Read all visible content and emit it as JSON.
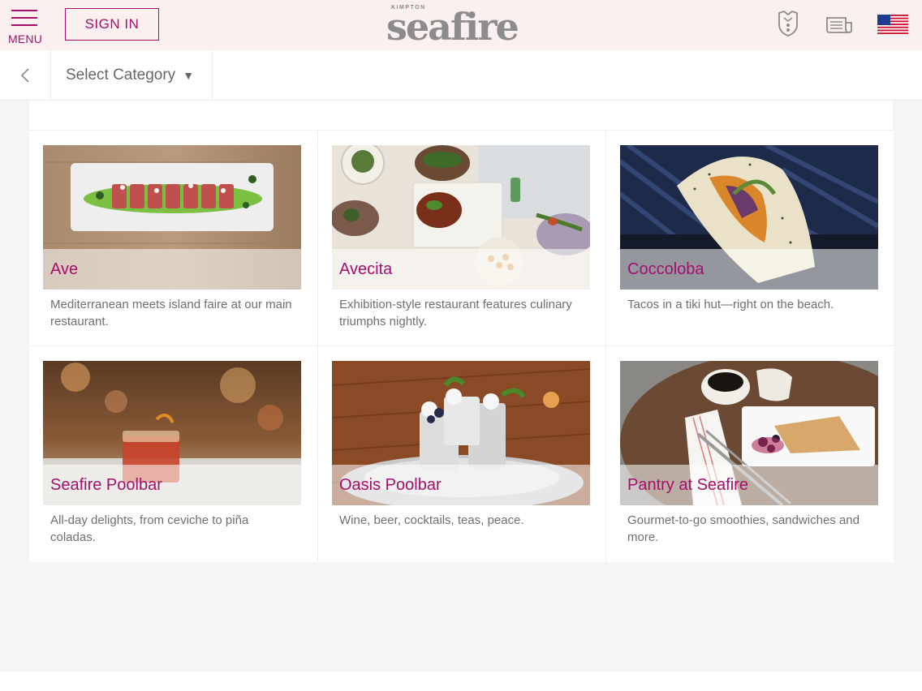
{
  "header": {
    "menu_label": "MENU",
    "signin_label": "SIGN IN",
    "logo_small": "KIMPTON",
    "logo_word": "seafire",
    "icons": [
      "crest-icon",
      "newspaper-icon",
      "us-flag-icon"
    ]
  },
  "category_bar": {
    "back_icon": "chevron-left-icon",
    "select_label": "Select Category",
    "select_caret": "▼"
  },
  "colors": {
    "accent": "#a3106c",
    "header_bg": "#fbf0f0",
    "page_bg": "#f5f5f5",
    "text_muted": "#6f6f6f"
  },
  "venues": [
    {
      "title": "Ave",
      "description": "Mediterranean meets island faire at our main restaurant."
    },
    {
      "title": "Avecita",
      "description": "Exhibition-style restaurant features culinary triumphs nightly."
    },
    {
      "title": "Coccoloba",
      "description": "Tacos in a tiki hut—right on the beach."
    },
    {
      "title": "Seafire Poolbar",
      "description": "All-day delights, from ceviche to piña coladas."
    },
    {
      "title": "Oasis Poolbar",
      "description": "Wine, beer, cocktails, teas, peace."
    },
    {
      "title": "Pantry at Seafire",
      "description": "Gourmet-to-go smoothies, sandwiches and more."
    }
  ]
}
